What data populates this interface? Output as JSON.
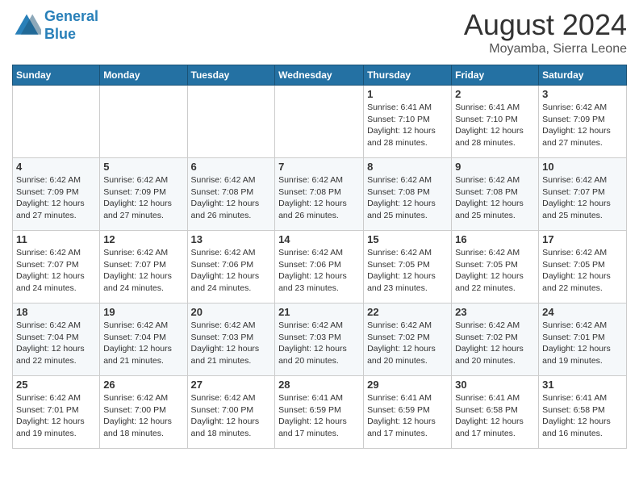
{
  "header": {
    "logo_line1": "General",
    "logo_line2": "Blue",
    "month_title": "August 2024",
    "location": "Moyamba, Sierra Leone"
  },
  "days_of_week": [
    "Sunday",
    "Monday",
    "Tuesday",
    "Wednesday",
    "Thursday",
    "Friday",
    "Saturday"
  ],
  "weeks": [
    [
      {
        "day": "",
        "info": ""
      },
      {
        "day": "",
        "info": ""
      },
      {
        "day": "",
        "info": ""
      },
      {
        "day": "",
        "info": ""
      },
      {
        "day": "1",
        "info": "Sunrise: 6:41 AM\nSunset: 7:10 PM\nDaylight: 12 hours\nand 28 minutes."
      },
      {
        "day": "2",
        "info": "Sunrise: 6:41 AM\nSunset: 7:10 PM\nDaylight: 12 hours\nand 28 minutes."
      },
      {
        "day": "3",
        "info": "Sunrise: 6:42 AM\nSunset: 7:09 PM\nDaylight: 12 hours\nand 27 minutes."
      }
    ],
    [
      {
        "day": "4",
        "info": "Sunrise: 6:42 AM\nSunset: 7:09 PM\nDaylight: 12 hours\nand 27 minutes."
      },
      {
        "day": "5",
        "info": "Sunrise: 6:42 AM\nSunset: 7:09 PM\nDaylight: 12 hours\nand 27 minutes."
      },
      {
        "day": "6",
        "info": "Sunrise: 6:42 AM\nSunset: 7:08 PM\nDaylight: 12 hours\nand 26 minutes."
      },
      {
        "day": "7",
        "info": "Sunrise: 6:42 AM\nSunset: 7:08 PM\nDaylight: 12 hours\nand 26 minutes."
      },
      {
        "day": "8",
        "info": "Sunrise: 6:42 AM\nSunset: 7:08 PM\nDaylight: 12 hours\nand 25 minutes."
      },
      {
        "day": "9",
        "info": "Sunrise: 6:42 AM\nSunset: 7:08 PM\nDaylight: 12 hours\nand 25 minutes."
      },
      {
        "day": "10",
        "info": "Sunrise: 6:42 AM\nSunset: 7:07 PM\nDaylight: 12 hours\nand 25 minutes."
      }
    ],
    [
      {
        "day": "11",
        "info": "Sunrise: 6:42 AM\nSunset: 7:07 PM\nDaylight: 12 hours\nand 24 minutes."
      },
      {
        "day": "12",
        "info": "Sunrise: 6:42 AM\nSunset: 7:07 PM\nDaylight: 12 hours\nand 24 minutes."
      },
      {
        "day": "13",
        "info": "Sunrise: 6:42 AM\nSunset: 7:06 PM\nDaylight: 12 hours\nand 24 minutes."
      },
      {
        "day": "14",
        "info": "Sunrise: 6:42 AM\nSunset: 7:06 PM\nDaylight: 12 hours\nand 23 minutes."
      },
      {
        "day": "15",
        "info": "Sunrise: 6:42 AM\nSunset: 7:05 PM\nDaylight: 12 hours\nand 23 minutes."
      },
      {
        "day": "16",
        "info": "Sunrise: 6:42 AM\nSunset: 7:05 PM\nDaylight: 12 hours\nand 22 minutes."
      },
      {
        "day": "17",
        "info": "Sunrise: 6:42 AM\nSunset: 7:05 PM\nDaylight: 12 hours\nand 22 minutes."
      }
    ],
    [
      {
        "day": "18",
        "info": "Sunrise: 6:42 AM\nSunset: 7:04 PM\nDaylight: 12 hours\nand 22 minutes."
      },
      {
        "day": "19",
        "info": "Sunrise: 6:42 AM\nSunset: 7:04 PM\nDaylight: 12 hours\nand 21 minutes."
      },
      {
        "day": "20",
        "info": "Sunrise: 6:42 AM\nSunset: 7:03 PM\nDaylight: 12 hours\nand 21 minutes."
      },
      {
        "day": "21",
        "info": "Sunrise: 6:42 AM\nSunset: 7:03 PM\nDaylight: 12 hours\nand 20 minutes."
      },
      {
        "day": "22",
        "info": "Sunrise: 6:42 AM\nSunset: 7:02 PM\nDaylight: 12 hours\nand 20 minutes."
      },
      {
        "day": "23",
        "info": "Sunrise: 6:42 AM\nSunset: 7:02 PM\nDaylight: 12 hours\nand 20 minutes."
      },
      {
        "day": "24",
        "info": "Sunrise: 6:42 AM\nSunset: 7:01 PM\nDaylight: 12 hours\nand 19 minutes."
      }
    ],
    [
      {
        "day": "25",
        "info": "Sunrise: 6:42 AM\nSunset: 7:01 PM\nDaylight: 12 hours\nand 19 minutes."
      },
      {
        "day": "26",
        "info": "Sunrise: 6:42 AM\nSunset: 7:00 PM\nDaylight: 12 hours\nand 18 minutes."
      },
      {
        "day": "27",
        "info": "Sunrise: 6:42 AM\nSunset: 7:00 PM\nDaylight: 12 hours\nand 18 minutes."
      },
      {
        "day": "28",
        "info": "Sunrise: 6:41 AM\nSunset: 6:59 PM\nDaylight: 12 hours\nand 17 minutes."
      },
      {
        "day": "29",
        "info": "Sunrise: 6:41 AM\nSunset: 6:59 PM\nDaylight: 12 hours\nand 17 minutes."
      },
      {
        "day": "30",
        "info": "Sunrise: 6:41 AM\nSunset: 6:58 PM\nDaylight: 12 hours\nand 17 minutes."
      },
      {
        "day": "31",
        "info": "Sunrise: 6:41 AM\nSunset: 6:58 PM\nDaylight: 12 hours\nand 16 minutes."
      }
    ]
  ]
}
